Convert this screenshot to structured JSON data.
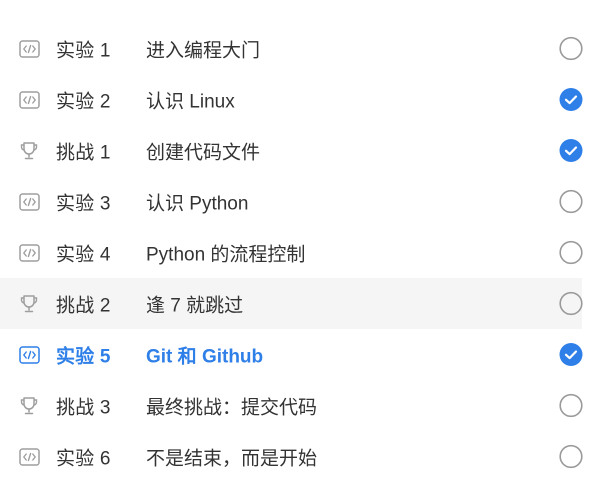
{
  "colors": {
    "accent": "#2f7fe8",
    "text": "#333333",
    "icon_gray": "#9e9e9e",
    "circle_gray": "#9a9a9a",
    "hover_bg": "#f5f5f5"
  },
  "rows": [
    {
      "type": "实验 1",
      "title": "进入编程大门",
      "icon": "code-icon",
      "completed": false,
      "active": false,
      "hovered": false
    },
    {
      "type": "实验 2",
      "title": "认识 Linux",
      "icon": "code-icon",
      "completed": true,
      "active": false,
      "hovered": false
    },
    {
      "type": "挑战 1",
      "title": "创建代码文件",
      "icon": "trophy-icon",
      "completed": true,
      "active": false,
      "hovered": false
    },
    {
      "type": "实验 3",
      "title": "认识 Python",
      "icon": "code-icon",
      "completed": false,
      "active": false,
      "hovered": false
    },
    {
      "type": "实验 4",
      "title": "Python 的流程控制",
      "icon": "code-icon",
      "completed": false,
      "active": false,
      "hovered": false
    },
    {
      "type": "挑战 2",
      "title": "逢 7 就跳过",
      "icon": "trophy-icon",
      "completed": false,
      "active": false,
      "hovered": true
    },
    {
      "type": "实验 5",
      "title": "Git 和 Github",
      "icon": "code-icon",
      "completed": true,
      "active": true,
      "hovered": false
    },
    {
      "type": "挑战 3",
      "title": "最终挑战：提交代码",
      "icon": "trophy-icon",
      "completed": false,
      "active": false,
      "hovered": false
    },
    {
      "type": "实验 6",
      "title": "不是结束，而是开始",
      "icon": "code-icon",
      "completed": false,
      "active": false,
      "hovered": false
    }
  ]
}
